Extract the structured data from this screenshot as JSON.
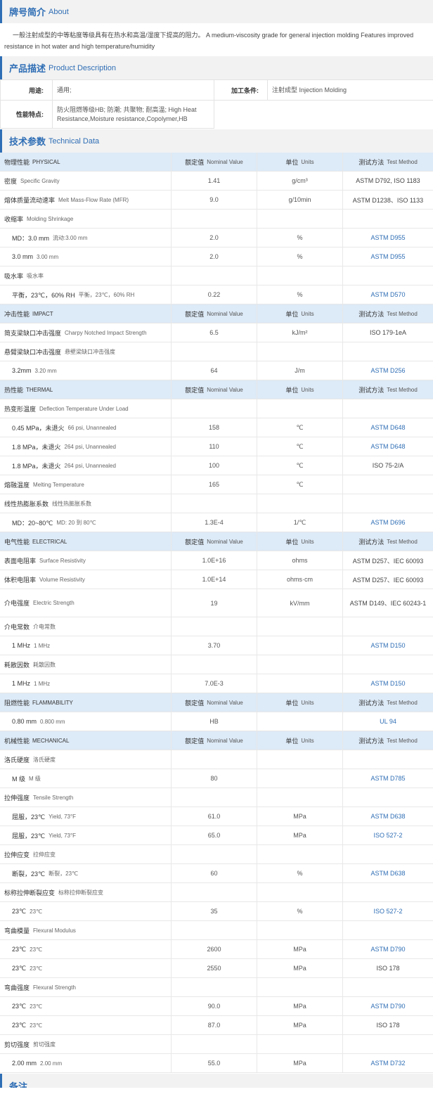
{
  "about": {
    "title_zh": "牌号简介",
    "title_en": "About",
    "text": "一般注射成型的中等粘度等级具有在热水和高温/湿度下提高的阻力。 A medium-viscosity grade for general injection molding Features improved resistance in hot water and high temperature/humidity"
  },
  "product": {
    "title_zh": "产品描述",
    "title_en": "Product Description",
    "usage_label": "用途:",
    "usage_value": "通用;",
    "process_label": "加工条件:",
    "process_value": "注射成型 Injection Molding",
    "features_label": "性能特点:",
    "features_value": "防火阻燃等级HB; 防潮; 共聚物; 耐高温; High Heat Resistance,Moisture resistance,Copolymer,HB"
  },
  "tech": {
    "title_zh": "技术参数",
    "title_en": "Technical Data",
    "header": {
      "nominal_zh": "额定值",
      "nominal_en": "Nominal Value",
      "units_zh": "单位",
      "units_en": "Units",
      "method_zh": "测试方法",
      "method_en": "Test Method"
    },
    "rows": [
      {
        "type": "cat",
        "zh": "物理性能",
        "en": "PHYSICAL"
      },
      {
        "type": "item",
        "zh": "密度",
        "en": "Specific Gravity",
        "value": "1.41",
        "unit": "g/cm³",
        "method": "ASTM D792, ISO 1183",
        "link": false
      },
      {
        "type": "item",
        "zh": "熔体质量流动速率",
        "en": "Melt Mass-Flow Rate (MFR)",
        "value": "9.0",
        "unit": "g/10min",
        "method": "ASTM D1238、ISO 1133",
        "link": false
      },
      {
        "type": "item",
        "zh": "收缩率",
        "en": "Molding Shrinkage",
        "value": "",
        "unit": "",
        "method": "",
        "link": false
      },
      {
        "type": "sub",
        "zh": "MD：3.0 mm",
        "en": "流动:3.00 mm",
        "value": "2.0",
        "unit": "%",
        "method": "ASTM D955",
        "link": true
      },
      {
        "type": "sub",
        "zh": "3.0 mm",
        "en": "3.00 mm",
        "value": "2.0",
        "unit": "%",
        "method": "ASTM D955",
        "link": true
      },
      {
        "type": "item",
        "zh": "吸水率",
        "en": "吸水率",
        "value": "",
        "unit": "",
        "method": "",
        "link": false
      },
      {
        "type": "sub",
        "zh": "平衡，23℃，60% RH",
        "en": "平衡，23℃，60% RH",
        "value": "0.22",
        "unit": "%",
        "method": "ASTM D570",
        "link": true
      },
      {
        "type": "cat",
        "zh": "冲击性能",
        "en": "IMPACT"
      },
      {
        "type": "item",
        "zh": "简支梁缺口冲击强度",
        "en": "Charpy Notched Impact Strength",
        "value": "6.5",
        "unit": "kJ/m²",
        "method": "ISO 179-1eA",
        "link": false
      },
      {
        "type": "item",
        "zh": "悬臂梁缺口冲击强度",
        "en": "悬壁梁缺口冲击强度",
        "value": "",
        "unit": "",
        "method": "",
        "link": false
      },
      {
        "type": "sub",
        "zh": "3.2mm",
        "en": "3.20 mm",
        "value": "64",
        "unit": "J/m",
        "method": "ASTM D256",
        "link": true
      },
      {
        "type": "cat",
        "zh": "热性能",
        "en": "THERMAL"
      },
      {
        "type": "item",
        "zh": "热变形温度",
        "en": "Deflection Temperature Under Load",
        "value": "",
        "unit": "",
        "method": "",
        "link": false
      },
      {
        "type": "sub",
        "zh": "0.45 MPa，未退火",
        "en": "66 psi, Unannealed",
        "value": "158",
        "unit": "℃",
        "method": "ASTM D648",
        "link": true
      },
      {
        "type": "sub",
        "zh": "1.8 MPa，未退火",
        "en": "264 psi, Unannealed",
        "value": "110",
        "unit": "℃",
        "method": "ASTM D648",
        "link": true
      },
      {
        "type": "sub",
        "zh": "1.8 MPa，未退火",
        "en": "264 psi, Unannealed",
        "value": "100",
        "unit": "℃",
        "method": "ISO 75-2/A",
        "link": false
      },
      {
        "type": "item",
        "zh": "熔融温度",
        "en": "Melting Temperature",
        "value": "165",
        "unit": "℃",
        "method": "",
        "link": false
      },
      {
        "type": "item",
        "zh": "线性热膨胀系数",
        "en": "线性热膨胀系数",
        "value": "",
        "unit": "",
        "method": "",
        "link": false
      },
      {
        "type": "sub",
        "zh": "MD：20~80℃",
        "en": "MD: 20 到 80℃",
        "value": "1.3E-4",
        "unit": "1/℃",
        "method": "ASTM D696",
        "link": true
      },
      {
        "type": "cat",
        "zh": "电气性能",
        "en": "ELECTRICAL"
      },
      {
        "type": "item",
        "zh": "表面电阻率",
        "en": "Surface Resistivity",
        "value": "1.0E+16",
        "unit": "ohms",
        "method": "ASTM D257、IEC 60093",
        "link": false
      },
      {
        "type": "item",
        "zh": "体积电阻率",
        "en": "Volume Resistivity",
        "value": "1.0E+14",
        "unit": "ohms·cm",
        "method": "ASTM D257、IEC 60093",
        "link": false
      },
      {
        "type": "item",
        "zh": "介电强度",
        "en": "Electric Strength",
        "value": "19",
        "unit": "kV/mm",
        "method": "ASTM D149、IEC 60243-1",
        "link": false,
        "tall": true
      },
      {
        "type": "item",
        "zh": "介电常数",
        "en": "介电常数",
        "value": "",
        "unit": "",
        "method": "",
        "link": false
      },
      {
        "type": "sub",
        "zh": "1 MHz",
        "en": "1 MHz",
        "value": "3.70",
        "unit": "",
        "method": "ASTM D150",
        "link": true
      },
      {
        "type": "item",
        "zh": "耗散因数",
        "en": "耗散因数",
        "value": "",
        "unit": "",
        "method": "",
        "link": false
      },
      {
        "type": "sub",
        "zh": "1 MHz",
        "en": "1 MHz",
        "value": "7.0E-3",
        "unit": "",
        "method": "ASTM D150",
        "link": true
      },
      {
        "type": "cat",
        "zh": "阻燃性能",
        "en": "FLAMMABILITY"
      },
      {
        "type": "itemsub",
        "zh": "0.80 mm",
        "en": "0.800 mm",
        "value": "HB",
        "unit": "",
        "method": "UL 94",
        "link": true
      },
      {
        "type": "cat",
        "zh": "机械性能",
        "en": "MECHANICAL"
      },
      {
        "type": "item",
        "zh": "洛氏硬度",
        "en": "洛氏硬度",
        "value": "",
        "unit": "",
        "method": "",
        "link": false
      },
      {
        "type": "sub",
        "zh": "M 级",
        "en": "M 级",
        "value": "80",
        "unit": "",
        "method": "ASTM D785",
        "link": true
      },
      {
        "type": "item",
        "zh": "拉伸强度",
        "en": "Tensile Strength",
        "value": "",
        "unit": "",
        "method": "",
        "link": false
      },
      {
        "type": "sub",
        "zh": "屈服，23℃",
        "en": "Yield, 73°F",
        "value": "61.0",
        "unit": "MPa",
        "method": "ASTM D638",
        "link": true
      },
      {
        "type": "sub",
        "zh": "屈服，23℃",
        "en": "Yield, 73°F",
        "value": "65.0",
        "unit": "MPa",
        "method": "ISO 527-2",
        "link": true
      },
      {
        "type": "item",
        "zh": "拉伸应变",
        "en": "拉伸应变",
        "value": "",
        "unit": "",
        "method": "",
        "link": false
      },
      {
        "type": "sub",
        "zh": "断裂，23℃",
        "en": "断裂，23℃",
        "value": "60",
        "unit": "%",
        "method": "ASTM D638",
        "link": true
      },
      {
        "type": "item",
        "zh": "标称拉伸断裂应变",
        "en": "标称拉伸断裂应变",
        "value": "",
        "unit": "",
        "method": "",
        "link": false
      },
      {
        "type": "sub",
        "zh": "23℃",
        "en": "23℃",
        "value": "35",
        "unit": "%",
        "method": "ISO 527-2",
        "link": true
      },
      {
        "type": "item",
        "zh": "弯曲模量",
        "en": "Flexural Modulus",
        "value": "",
        "unit": "",
        "method": "",
        "link": false
      },
      {
        "type": "sub",
        "zh": "23℃",
        "en": "23℃",
        "value": "2600",
        "unit": "MPa",
        "method": "ASTM D790",
        "link": true
      },
      {
        "type": "sub",
        "zh": "23℃",
        "en": "23℃",
        "value": "2550",
        "unit": "MPa",
        "method": "ISO 178",
        "link": false
      },
      {
        "type": "item",
        "zh": "弯曲强度",
        "en": "Flexural Strength",
        "value": "",
        "unit": "",
        "method": "",
        "link": false
      },
      {
        "type": "sub",
        "zh": "23℃",
        "en": "23℃",
        "value": "90.0",
        "unit": "MPa",
        "method": "ASTM D790",
        "link": true
      },
      {
        "type": "sub",
        "zh": "23℃",
        "en": "23℃",
        "value": "87.0",
        "unit": "MPa",
        "method": "ISO 178",
        "link": false
      },
      {
        "type": "item",
        "zh": "剪切强度",
        "en": "剪切强度",
        "value": "",
        "unit": "",
        "method": "",
        "link": false
      },
      {
        "type": "sub",
        "zh": "2.00 mm",
        "en": "2.00 mm",
        "value": "55.0",
        "unit": "MPa",
        "method": "ASTM D732",
        "link": true
      }
    ]
  },
  "notes": {
    "title_zh": "备注"
  },
  "colors": {
    "accent": "#2f6eb5",
    "category_bg": "#ddeaf7",
    "section_bg": "#f2f2f2"
  }
}
